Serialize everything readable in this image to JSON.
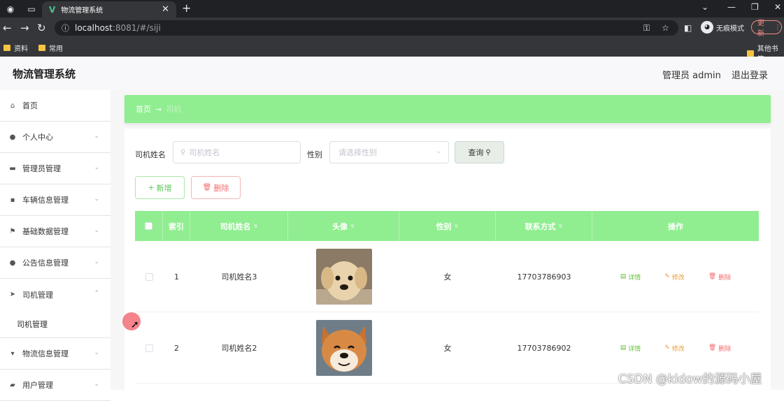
{
  "browser": {
    "tab_title": "物流管理系统",
    "url_host": "localhost",
    "url_rest": ":8081/#/siji",
    "incognito_label": "无痕模式",
    "update_label": "更新",
    "bookmarks": [
      "资料",
      "常用"
    ],
    "other_bookmarks": "其他书签"
  },
  "app": {
    "title": "物流管理系统",
    "user_label": "管理员 admin",
    "logout_label": "退出登录"
  },
  "sidebar": {
    "items": [
      {
        "label": "首页",
        "icon": "home-icon"
      },
      {
        "label": "个人中心",
        "icon": "user-icon"
      },
      {
        "label": "管理员管理",
        "icon": "briefcase-icon"
      },
      {
        "label": "车辆信息管理",
        "icon": "message-icon"
      },
      {
        "label": "基础数据管理",
        "icon": "flag-icon"
      },
      {
        "label": "公告信息管理",
        "icon": "bulb-icon"
      },
      {
        "label": "司机管理",
        "icon": "send-icon"
      },
      {
        "label": "物流信息管理",
        "icon": "post-icon"
      },
      {
        "label": "用户管理",
        "icon": "folder-icon"
      }
    ],
    "submenu_active": "司机管理"
  },
  "breadcrumb": {
    "home": "首页",
    "current": "司机"
  },
  "search": {
    "name_label": "司机姓名",
    "name_placeholder": "司机姓名",
    "gender_label": "性别",
    "gender_placeholder": "请选择性别",
    "query_label": "查询"
  },
  "actions": {
    "add_label": "新增",
    "delete_label": "删除"
  },
  "table": {
    "columns": [
      "索引",
      "司机姓名",
      "头像",
      "性别",
      "联系方式",
      "操作"
    ],
    "rows": [
      {
        "index": "1",
        "name": "司机姓名3",
        "gender": "女",
        "phone": "17703786903",
        "avatar": "puppy-golden"
      },
      {
        "index": "2",
        "name": "司机姓名2",
        "gender": "女",
        "phone": "17703786902",
        "avatar": "shiba-inu"
      }
    ],
    "op_detail": "详情",
    "op_edit": "修改",
    "op_delete": "删除"
  },
  "watermark": "CSDN @kidow的源码小屋",
  "colors": {
    "accent_green": "#90ee90",
    "detail_green": "#67c23a",
    "edit_orange": "#e6a23c",
    "delete_red": "#f56c6c"
  }
}
